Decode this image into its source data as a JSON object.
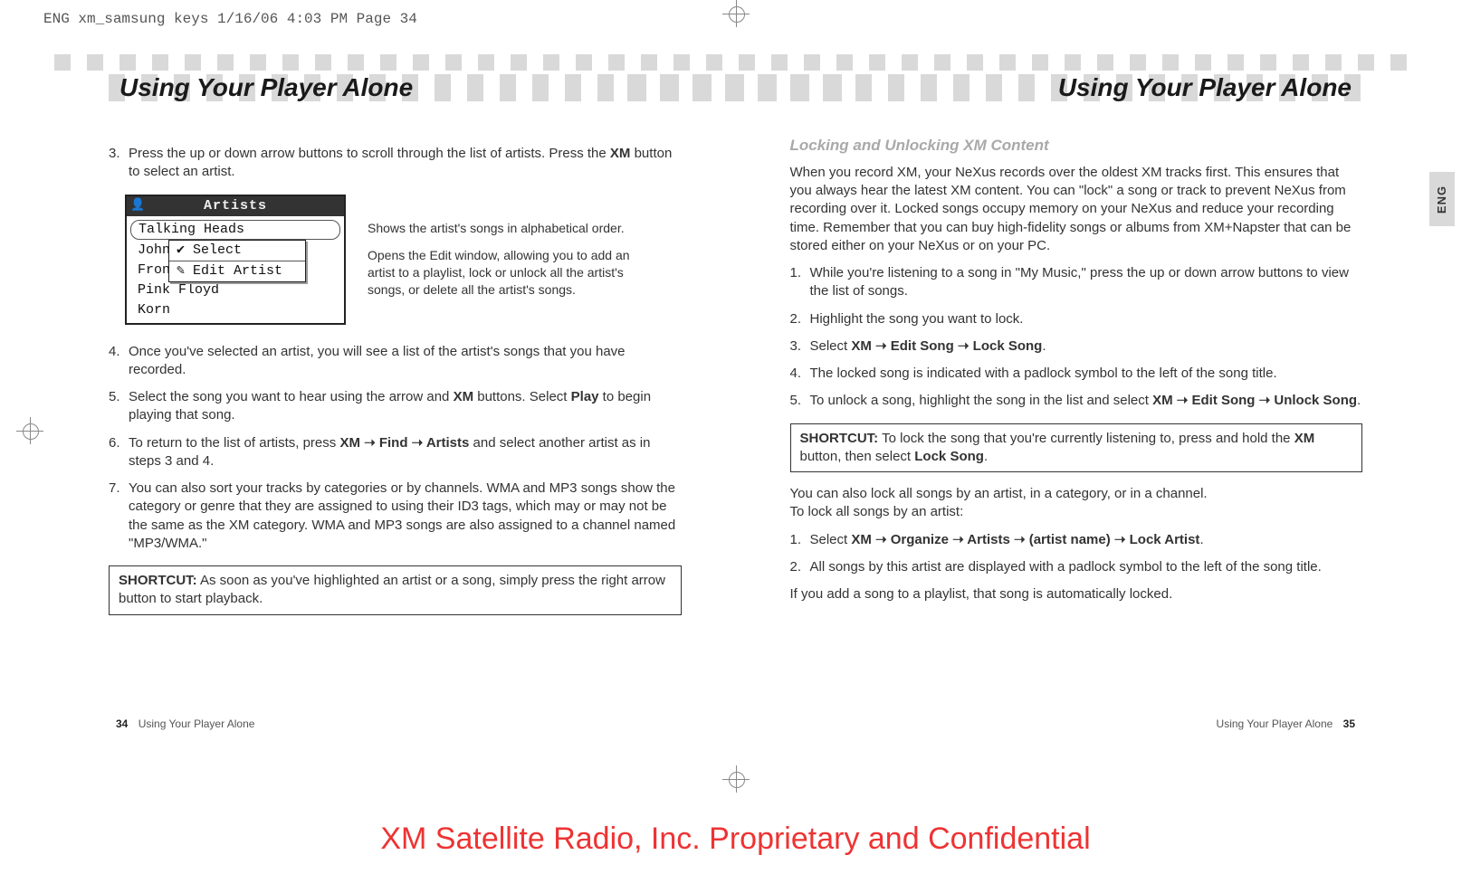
{
  "slug": "ENG xm_samsung keys  1/16/06  4:03 PM  Page 34",
  "header": {
    "left_title": "Using Your Player Alone",
    "right_title": "Using Your Player Alone"
  },
  "lang_tab": "ENG",
  "left_col": {
    "step3": "Press the up or down arrow buttons to scroll through the list of artists. Press the ",
    "step3_bold": "XM",
    "step3_cont": " button to select an artist.",
    "lcd": {
      "title": "Artists",
      "rows": [
        "Talking Heads",
        "John",
        "Fron",
        "Pink Floyd",
        "Korn"
      ],
      "popup": [
        "✔ Select",
        "✎ Edit Artist"
      ]
    },
    "callouts": {
      "c1": "Shows the artist's songs in alphabetical order.",
      "c2": "Opens the Edit window, allowing you to add an artist to a playlist, lock or unlock all the artist's songs, or delete all the artist's songs."
    },
    "step4": "Once you've selected an artist, you will see a list of the artist's songs that you have recorded.",
    "step5_a": "Select the song you want to hear using the arrow and ",
    "step5_xm": "XM",
    "step5_b": " buttons. Select ",
    "step5_play": "Play",
    "step5_c": " to begin playing that song.",
    "step6_a": "To return to the list of artists, press ",
    "step6_path": "XM ➝ Find ➝ Artists",
    "step6_b": " and select another artist as in steps 3 and 4.",
    "step7": "You can also sort your tracks by categories or by channels. WMA and MP3 songs show the category or genre that they are assigned to using their ID3 tags, which may or may not be the same as the XM category. WMA and MP3 songs are also assigned to a channel named \"MP3/WMA.\"",
    "shortcut_label": "SHORTCUT:",
    "shortcut_text": " As soon as you've highlighted an artist or a song, simply press the right arrow button to start playback."
  },
  "right_col": {
    "section_title": "Locking and Unlocking XM Content",
    "intro": "When you record XM, your NeXus records over the oldest XM tracks first. This ensures that you always hear the latest XM content. You can \"lock\" a song or track to prevent NeXus from recording over it. Locked songs occupy memory on your NeXus and reduce your recording time. Remember that you can buy high-fidelity songs or albums from XM+Napster that can be stored either on your NeXus or on your PC.",
    "s1": "While you're listening to a song in \"My Music,\" press the up or down arrow buttons to view the list of songs.",
    "s2": "Highlight the song you want to lock.",
    "s3_a": "Select ",
    "s3_path": "XM ➝ Edit Song ➝ Lock Song",
    "s3_b": ".",
    "s4": "The locked song is indicated with a padlock symbol to the left of the song title.",
    "s5_a": "To unlock a song, highlight the song in the list and select ",
    "s5_path": "XM ➝ Edit Song ➝ Unlock Song",
    "s5_b": ".",
    "shortcut_label": "SHORTCUT:",
    "shortcut_a": " To lock the song that you're currently listening to, press and hold the ",
    "shortcut_xm": "XM",
    "shortcut_b": " button, then select ",
    "shortcut_lock": "Lock Song",
    "shortcut_c": ".",
    "para2_a": "You can also lock all songs by an artist, in a category, or in a channel.",
    "para2_b": "To lock all songs by an artist:",
    "b1_a": "Select ",
    "b1_path": "XM ➝ Organize ➝ Artists ➝ (artist name) ➝ Lock Artist",
    "b1_b": ".",
    "b2": "All songs by this artist are displayed with a padlock symbol to the left of the song title.",
    "para3": "If you add a song to a playlist, that song is automatically locked."
  },
  "footer": {
    "left_page": "34",
    "left_text": "Using Your Player Alone",
    "right_text": "Using Your Player Alone",
    "right_page": "35"
  },
  "confidential": "XM Satellite Radio, Inc. Proprietary and Confidential"
}
